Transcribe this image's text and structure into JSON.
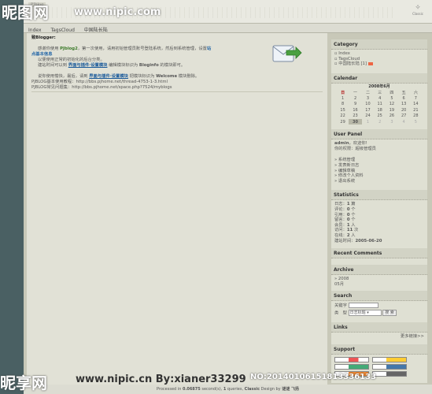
{
  "header": {
    "logo": "PJblog",
    "classic_label": "Classic"
  },
  "nav": [
    "Index",
    "TagsCloud",
    "中国陆长陆"
  ],
  "content": {
    "greeting": "致Blogger:",
    "line1_a": "感谢你使用 ",
    "line1_b": "PJblog2",
    "line1_c": "，第一次使用，请用初始管理员账号登陆系统，然后到系统管理，设置",
    "line1_d": "站",
    "line2": "点基本信息",
    "line3": "以便使用正常的初始化的后台分类。",
    "line4_a": "建站时间可以到 ",
    "line4_b": "界面与插件·设置模块",
    "line4_c": " 编辑模块标识为 ",
    "line4_d": "Bloginfo",
    "line4_e": " 的模块即可。",
    "line5_a": "说你使用愉快，最后，请到 ",
    "line5_b": "界面与插件·设置模块",
    "line5_c": " 把模块标识为 ",
    "line5_d": "Welcome",
    "line5_e": " 模块删除。",
    "link1": "PJBLOG基本使用教程：http://bbs.pjhome.net/thread-4753-1-3.html",
    "link2": "PJBLOG常见问题集：http://bbs.pjhome.net/space.php?7524/myblogs"
  },
  "sidebar": {
    "category": {
      "title": "Category",
      "items": [
        "Index",
        "TagsCloud",
        "中国陆长陆 [1]"
      ]
    },
    "calendar": {
      "title": "Calendar",
      "caption": "2008年6月",
      "weekdays": [
        "日",
        "一",
        "二",
        "三",
        "四",
        "五",
        "六"
      ],
      "weeks": [
        [
          "1",
          "2",
          "3",
          "4",
          "5",
          "6",
          "7"
        ],
        [
          "8",
          "9",
          "10",
          "11",
          "12",
          "13",
          "14"
        ],
        [
          "15",
          "16",
          "17",
          "18",
          "19",
          "20",
          "21"
        ],
        [
          "22",
          "23",
          "24",
          "25",
          "26",
          "27",
          "28"
        ],
        [
          "29",
          "30",
          "1",
          "2",
          "3",
          "4",
          "5"
        ]
      ]
    },
    "user_panel": {
      "title": "User Panel",
      "welcome_name": "admin",
      "welcome_suffix": "，欢迎你!",
      "rights": "你的权限：超级管理员",
      "links": [
        "» 系统管理",
        "» 发表新日志",
        "» 编辑草稿",
        "» 修改个人资料",
        "» 退出系统"
      ]
    },
    "statistics": {
      "title": "Statistics",
      "rows": [
        [
          "日志：",
          "1",
          " 篇"
        ],
        [
          "评论：",
          "0",
          " 个"
        ],
        [
          "引用：",
          "0",
          " 个"
        ],
        [
          "留言：",
          "0",
          " 个"
        ],
        [
          "会员：",
          "1",
          " 人"
        ],
        [
          "访问：",
          "11",
          " 次"
        ],
        [
          "在线：",
          "2",
          " 人"
        ],
        [
          "建站时间：",
          "2005-06-20",
          ""
        ]
      ]
    },
    "recent_comments": {
      "title": "Recent Comments"
    },
    "archive": {
      "title": "Archive",
      "year": "» 2008",
      "month": "05月"
    },
    "search": {
      "title": "Search",
      "keyword_label": "关键字",
      "type_label": "类　型",
      "select_value": "日志标题",
      "button_label": "搜 索"
    },
    "links": {
      "title": "Links",
      "more": "更多链接>>"
    },
    "support": {
      "title": "Support"
    }
  },
  "footer": {
    "processed_prefix": "Processed in ",
    "processed_time": "0.06875",
    "processed_mid": " second(s), ",
    "queries": "1",
    "queries_suffix": " queries, ",
    "theme_label": "Classic",
    "theme_design": " Design by ",
    "designer": "谜谜 飞扬"
  },
  "watermark": {
    "tl": "昵图网",
    "url": "www.nipic.com",
    "bl": "昵享网",
    "burl": "www.nipic.cn",
    "by": "By:xianer33299",
    "id": "NO:20140106151813336133"
  }
}
